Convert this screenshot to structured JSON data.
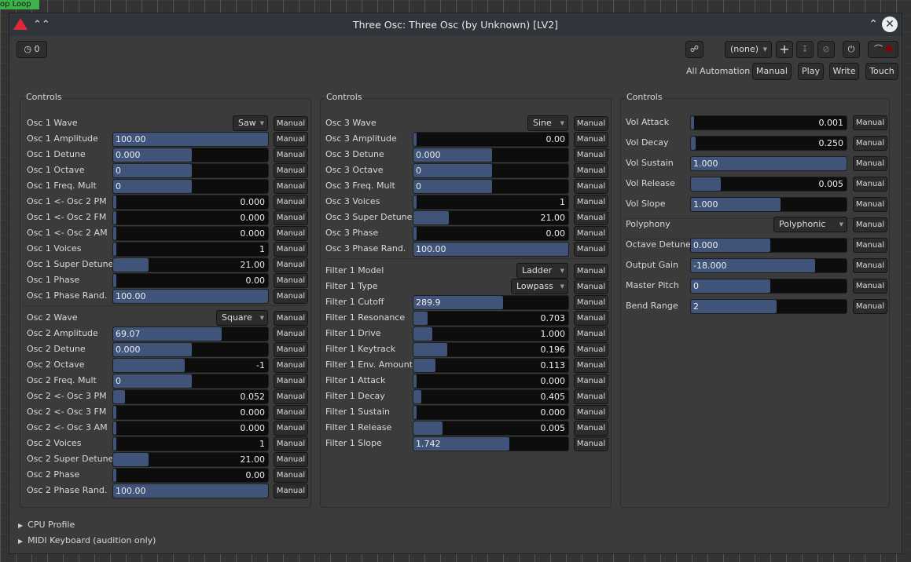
{
  "window": {
    "title": "Three Osc: Three Osc (by Unknown) [LV2]",
    "background_label": "op Loop"
  },
  "toolbar": {
    "latency": "0",
    "preset": "(none)",
    "all_automation": "All Automation",
    "auto_buttons": [
      "Manual",
      "Play",
      "Write",
      "Touch"
    ]
  },
  "manual_label": "Manual",
  "columns": [
    {
      "title": "Controls",
      "rows": [
        {
          "label": "Osc 1 Wave",
          "combo": "Saw"
        },
        {
          "label": "Osc 1 Amplitude",
          "value": "100.00",
          "fill": 1.0,
          "align": "left"
        },
        {
          "label": "Osc 1 Detune",
          "value": "0.000",
          "fill": 0.51,
          "align": "left"
        },
        {
          "label": "Osc 1 Octave",
          "value": "0",
          "fill": 0.51,
          "align": "left"
        },
        {
          "label": "Osc 1 Freq. Mult",
          "value": "0",
          "fill": 0.51,
          "align": "left"
        },
        {
          "label": "Osc 1 <- Osc 2 PM",
          "value": "0.000",
          "fill": 0.02,
          "align": "right"
        },
        {
          "label": "Osc 1 <- Osc 2 FM",
          "value": "0.000",
          "fill": 0.02,
          "align": "right"
        },
        {
          "label": "Osc 1 <- Osc 2 AM",
          "value": "0.000",
          "fill": 0.02,
          "align": "right"
        },
        {
          "label": "Osc 1 Voices",
          "value": "1",
          "fill": 0.02,
          "align": "right"
        },
        {
          "label": "Osc 1 Super Detune",
          "value": "21.00",
          "fill": 0.23,
          "align": "right"
        },
        {
          "label": "Osc 1 Phase",
          "value": "0.00",
          "fill": 0.02,
          "align": "right"
        },
        {
          "label": "Osc 1 Phase Rand.",
          "value": "100.00",
          "fill": 1.0,
          "align": "left",
          "sep": true
        },
        {
          "label": "Osc 2 Wave",
          "combo": "Square"
        },
        {
          "label": "Osc 2 Amplitude",
          "value": "69.07",
          "fill": 0.7,
          "align": "left"
        },
        {
          "label": "Osc 2 Detune",
          "value": "0.000",
          "fill": 0.51,
          "align": "left"
        },
        {
          "label": "Osc 2 Octave",
          "value": "-1",
          "fill": 0.46,
          "align": "right"
        },
        {
          "label": "Osc 2 Freq. Mult",
          "value": "0",
          "fill": 0.51,
          "align": "left"
        },
        {
          "label": "Osc 2 <- Osc 3 PM",
          "value": "0.052",
          "fill": 0.075,
          "align": "right"
        },
        {
          "label": "Osc 2 <- Osc 3 FM",
          "value": "0.000",
          "fill": 0.02,
          "align": "right"
        },
        {
          "label": "Osc 2 <- Osc 3 AM",
          "value": "0.000",
          "fill": 0.02,
          "align": "right"
        },
        {
          "label": "Osc 2 Voices",
          "value": "1",
          "fill": 0.02,
          "align": "right"
        },
        {
          "label": "Osc 2 Super Detune",
          "value": "21.00",
          "fill": 0.23,
          "align": "right"
        },
        {
          "label": "Osc 2 Phase",
          "value": "0.00",
          "fill": 0.02,
          "align": "right"
        },
        {
          "label": "Osc 2 Phase Rand.",
          "value": "100.00",
          "fill": 1.0,
          "align": "left"
        }
      ]
    },
    {
      "title": "Controls",
      "rows": [
        {
          "label": "Osc 3 Wave",
          "combo": "Sine"
        },
        {
          "label": "Osc 3 Amplitude",
          "value": "0.00",
          "fill": 0.02,
          "align": "right"
        },
        {
          "label": "Osc 3 Detune",
          "value": "0.000",
          "fill": 0.51,
          "align": "left"
        },
        {
          "label": "Osc 3 Octave",
          "value": "0",
          "fill": 0.51,
          "align": "left"
        },
        {
          "label": "Osc 3 Freq. Mult",
          "value": "0",
          "fill": 0.51,
          "align": "left"
        },
        {
          "label": "Osc 3 Voices",
          "value": "1",
          "fill": 0.02,
          "align": "right"
        },
        {
          "label": "Osc 3 Super Detune",
          "value": "21.00",
          "fill": 0.23,
          "align": "right"
        },
        {
          "label": "Osc 3 Phase",
          "value": "0.00",
          "fill": 0.02,
          "align": "right"
        },
        {
          "label": "Osc 3 Phase Rand.",
          "value": "100.00",
          "fill": 1.0,
          "align": "left",
          "sep": true
        },
        {
          "label": "Filter 1 Model",
          "combo": "Ladder"
        },
        {
          "label": "Filter 1 Type",
          "combo": "Lowpass"
        },
        {
          "label": "Filter 1 Cutoff",
          "value": "289.9",
          "fill": 0.58,
          "align": "left"
        },
        {
          "label": "Filter 1 Resonance",
          "value": "0.703",
          "fill": 0.09,
          "align": "right"
        },
        {
          "label": "Filter 1 Drive",
          "value": "1.000",
          "fill": 0.12,
          "align": "right"
        },
        {
          "label": "Filter 1 Keytrack",
          "value": "0.196",
          "fill": 0.22,
          "align": "right"
        },
        {
          "label": "Filter 1 Env. Amount",
          "value": "0.113",
          "fill": 0.14,
          "align": "right"
        },
        {
          "label": "Filter 1 Attack",
          "value": "0.000",
          "fill": 0.02,
          "align": "right"
        },
        {
          "label": "Filter 1 Decay",
          "value": "0.405",
          "fill": 0.05,
          "align": "right"
        },
        {
          "label": "Filter 1 Sustain",
          "value": "0.000",
          "fill": 0.02,
          "align": "right"
        },
        {
          "label": "Filter 1 Release",
          "value": "0.005",
          "fill": 0.19,
          "align": "right"
        },
        {
          "label": "Filter 1 Slope",
          "value": "1.742",
          "fill": 0.62,
          "align": "left"
        }
      ]
    },
    {
      "title": "Controls",
      "rows": [
        {
          "label": "Vol Attack",
          "value": "0.001",
          "fill": 0.02,
          "align": "right"
        },
        {
          "label": "Vol Decay",
          "value": "0.250",
          "fill": 0.03,
          "align": "right"
        },
        {
          "label": "Vol Sustain",
          "value": "1.000",
          "fill": 1.0,
          "align": "left"
        },
        {
          "label": "Vol Release",
          "value": "0.005",
          "fill": 0.19,
          "align": "right"
        },
        {
          "label": "Vol Slope",
          "value": "1.000",
          "fill": 0.575,
          "align": "left",
          "sep": true
        },
        {
          "label": "Polyphony",
          "combo": "Polyphonic",
          "sep": true
        },
        {
          "label": "Octave Detune",
          "value": "0.000",
          "fill": 0.51,
          "align": "left"
        },
        {
          "label": "Output Gain",
          "value": "-18.000",
          "fill": 0.8,
          "align": "left"
        },
        {
          "label": "Master Pitch",
          "value": "0",
          "fill": 0.51,
          "align": "left"
        },
        {
          "label": "Bend Range",
          "value": "2",
          "fill": 0.55,
          "align": "left"
        }
      ]
    }
  ],
  "expanders": [
    "CPU Profile",
    "MIDI Keyboard (audition only)"
  ]
}
